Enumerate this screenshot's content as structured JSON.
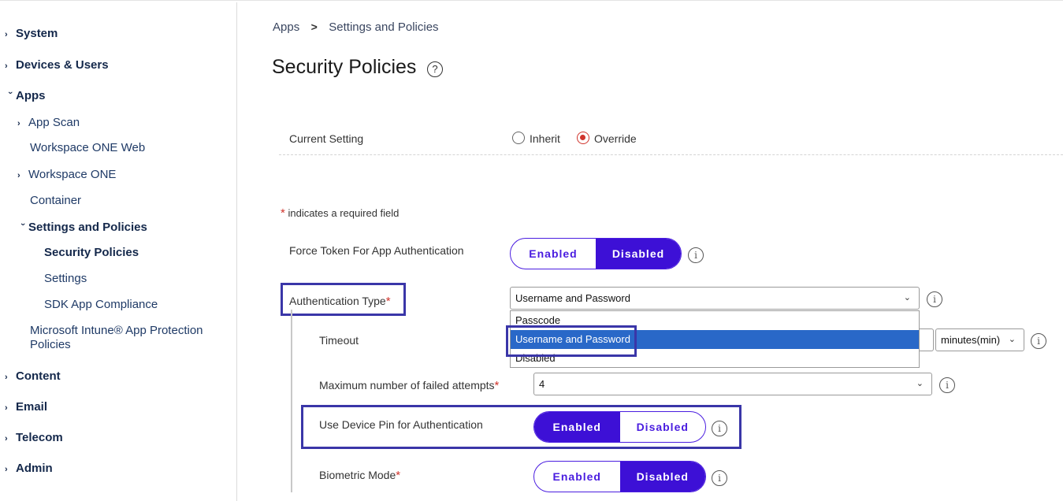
{
  "sidebar": {
    "system": "System",
    "devices_users": "Devices & Users",
    "apps": "Apps",
    "app_scan": "App Scan",
    "workspace_one_web": "Workspace ONE Web",
    "workspace_one": "Workspace ONE",
    "container": "Container",
    "settings_and_policies": "Settings and Policies",
    "security_policies": "Security Policies",
    "settings": "Settings",
    "sdk_app_compliance": "SDK App Compliance",
    "intune_line1": "Microsoft Intune® App Protection",
    "intune_line2": "Policies",
    "content": "Content",
    "email": "Email",
    "telecom": "Telecom",
    "admin": "Admin"
  },
  "breadcrumb": {
    "apps": "Apps",
    "separator": ">",
    "current": "Settings and Policies"
  },
  "page_title": "Security Policies",
  "current_setting": {
    "label": "Current Setting",
    "inherit": "Inherit",
    "override": "Override",
    "selected": "Override"
  },
  "required_note": "indicates a required field",
  "required_mark": "*",
  "force_token": {
    "label": "Force Token For App Authentication",
    "enabled": "Enabled",
    "disabled": "Disabled",
    "selected": "Disabled"
  },
  "auth_type": {
    "label": "Authentication Type",
    "value": "Username and Password",
    "options": [
      "Passcode",
      "Username and Password",
      "Disabled"
    ]
  },
  "timeout": {
    "label": "Timeout",
    "unit": "minutes(min)"
  },
  "max_failed": {
    "label": "Maximum number of failed attempts",
    "value": "4"
  },
  "device_pin": {
    "label": "Use Device Pin for Authentication",
    "enabled": "Enabled",
    "disabled": "Disabled",
    "selected": "Enabled"
  },
  "biometric": {
    "label": "Biometric Mode",
    "enabled": "Enabled",
    "disabled": "Disabled",
    "selected": "Disabled"
  },
  "icons": {
    "help": "question-circle-icon",
    "info": "info-circle-icon",
    "chevron": "chevron-icon",
    "caret": "caret-down-icon"
  },
  "colors": {
    "accent": "#3d10d6",
    "required": "#d0342c",
    "highlight": "#3a36a8",
    "selection": "#2968c8"
  }
}
